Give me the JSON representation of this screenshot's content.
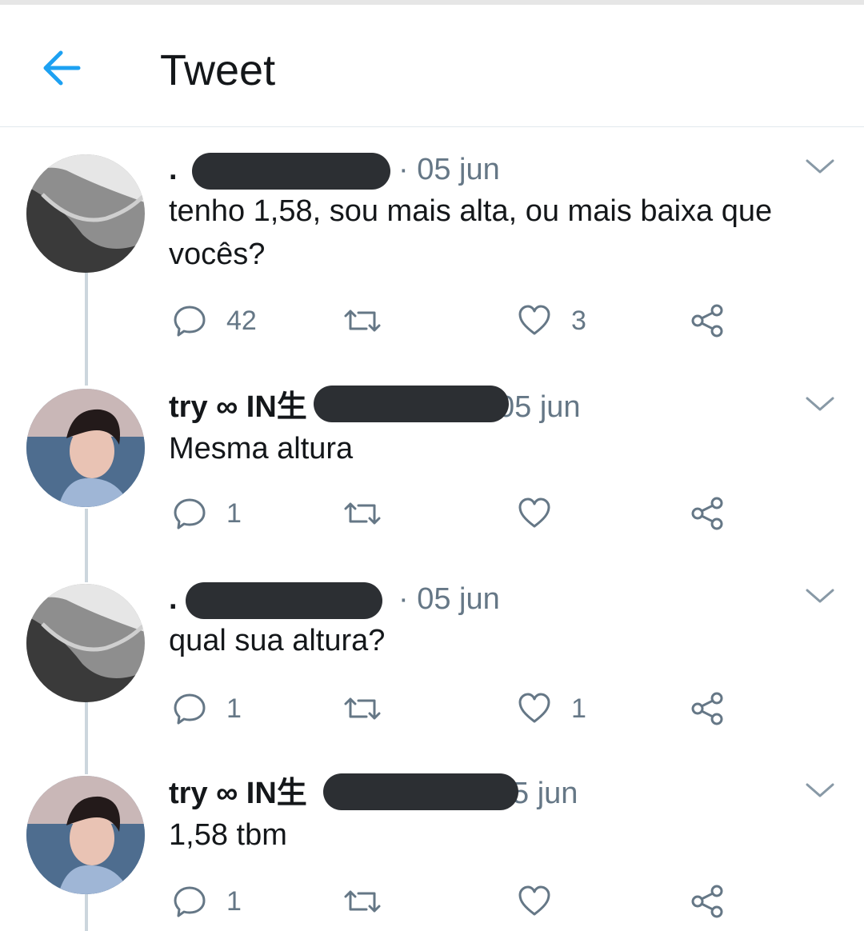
{
  "header": {
    "title": "Tweet"
  },
  "tweets": [
    {
      "name": ".",
      "time": "· 05 jun",
      "text": "tenho 1,58, sou mais alta, ou mais baixa que vocês?",
      "replies": "42",
      "retweets": "",
      "likes": "3"
    },
    {
      "name": "try ∞ IN生",
      "time": "05 jun",
      "text": "Mesma altura",
      "replies": "1",
      "retweets": "",
      "likes": ""
    },
    {
      "name": ".",
      "time": "· 05 jun",
      "text": "qual sua altura?",
      "replies": "1",
      "retweets": "",
      "likes": "1"
    },
    {
      "name": "try ∞ IN生",
      "time": "5 jun",
      "text": "1,58 tbm",
      "replies": "1",
      "retweets": "",
      "likes": ""
    }
  ],
  "icons": {
    "back": "arrow-left-icon",
    "caret": "chevron-down-icon",
    "reply": "reply-icon",
    "retweet": "retweet-icon",
    "like": "heart-icon",
    "share": "share-icon"
  },
  "colors": {
    "accent": "#1da1f2",
    "text": "#14171a",
    "muted": "#657786",
    "line": "#ccd6dd",
    "redaction": "#2c2f33"
  }
}
